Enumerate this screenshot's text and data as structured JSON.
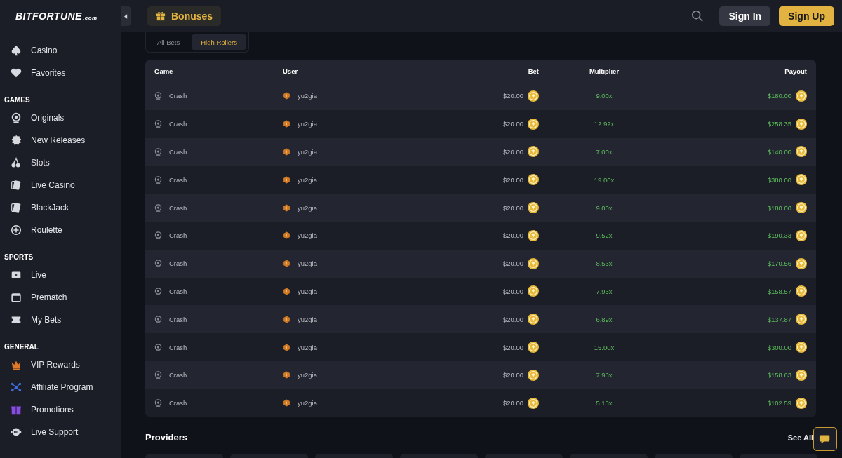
{
  "logo": {
    "main": "BITFORTUNE",
    "suffix": ".com"
  },
  "header": {
    "bonuses": "Bonuses",
    "sign_in": "Sign In",
    "sign_up": "Sign Up"
  },
  "sidebar": {
    "sections": [
      {
        "items": [
          {
            "label": "Casino"
          },
          {
            "label": "Favorites"
          }
        ]
      },
      {
        "title": "GAMES",
        "items": [
          {
            "label": "Originals"
          },
          {
            "label": "New Releases"
          },
          {
            "label": "Slots"
          },
          {
            "label": "Live Casino"
          },
          {
            "label": "BlackJack"
          },
          {
            "label": "Roulette"
          }
        ]
      },
      {
        "title": "SPORTS",
        "items": [
          {
            "label": "Live"
          },
          {
            "label": "Prematch"
          },
          {
            "label": "My Bets"
          }
        ]
      },
      {
        "title": "GENERAL",
        "items": [
          {
            "label": "VIP Rewards",
            "color": "#e0782a"
          },
          {
            "label": "Affiliate Program",
            "color": "#3f6fe0"
          },
          {
            "label": "Promotions",
            "color": "#8a4ae6"
          },
          {
            "label": "Live Support"
          }
        ]
      }
    ]
  },
  "tabs": [
    {
      "label": "All Bets",
      "selected": false
    },
    {
      "label": "High Rollers",
      "selected": true
    }
  ],
  "table": {
    "columns": [
      "Game",
      "User",
      "Bet",
      "Multiplier",
      "Payout"
    ],
    "rows": [
      {
        "game": "Crash",
        "user": "yu2gia",
        "bet": "$20.00",
        "multiplier": "9.00x",
        "payout": "$180.00"
      },
      {
        "game": "Crash",
        "user": "yu2gia",
        "bet": "$20.00",
        "multiplier": "12.92x",
        "payout": "$258.35"
      },
      {
        "game": "Crash",
        "user": "yu2gia",
        "bet": "$20.00",
        "multiplier": "7.00x",
        "payout": "$140.00"
      },
      {
        "game": "Crash",
        "user": "yu2gia",
        "bet": "$20.00",
        "multiplier": "19.00x",
        "payout": "$380.00"
      },
      {
        "game": "Crash",
        "user": "yu2gia",
        "bet": "$20.00",
        "multiplier": "9.00x",
        "payout": "$180.00"
      },
      {
        "game": "Crash",
        "user": "yu2gia",
        "bet": "$20.00",
        "multiplier": "9.52x",
        "payout": "$190.33"
      },
      {
        "game": "Crash",
        "user": "yu2gia",
        "bet": "$20.00",
        "multiplier": "8.53x",
        "payout": "$170.56"
      },
      {
        "game": "Crash",
        "user": "yu2gia",
        "bet": "$20.00",
        "multiplier": "7.93x",
        "payout": "$158.57"
      },
      {
        "game": "Crash",
        "user": "yu2gia",
        "bet": "$20.00",
        "multiplier": "6.89x",
        "payout": "$137.87"
      },
      {
        "game": "Crash",
        "user": "yu2gia",
        "bet": "$20.00",
        "multiplier": "15.00x",
        "payout": "$300.00"
      },
      {
        "game": "Crash",
        "user": "yu2gia",
        "bet": "$20.00",
        "multiplier": "7.93x",
        "payout": "$158.63"
      },
      {
        "game": "Crash",
        "user": "yu2gia",
        "bet": "$20.00",
        "multiplier": "5.13x",
        "payout": "$102.59"
      }
    ]
  },
  "providers": {
    "title": "Providers",
    "see_all": "See All"
  }
}
